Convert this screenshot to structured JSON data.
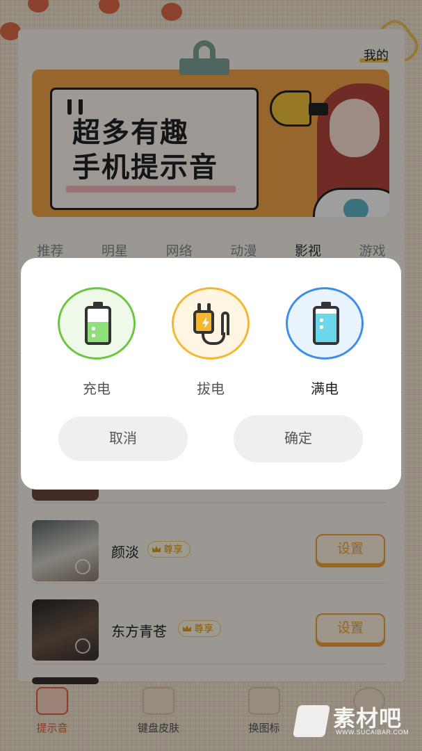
{
  "header": {
    "mine_label": "我的"
  },
  "banner": {
    "line1": "超多有趣",
    "line2": "手机提示音"
  },
  "categories": [
    {
      "label": "推荐",
      "active": false
    },
    {
      "label": "明星",
      "active": false
    },
    {
      "label": "网络",
      "active": false
    },
    {
      "label": "动漫",
      "active": false
    },
    {
      "label": "影视",
      "active": true
    },
    {
      "label": "游戏",
      "active": false
    }
  ],
  "list": [
    {
      "name": "颜淡",
      "badge": "尊享",
      "action": "设置"
    },
    {
      "name": "东方青苍",
      "badge": "尊享",
      "action": "设置"
    }
  ],
  "tabbar": [
    {
      "label": "提示音",
      "icon": "bell-icon",
      "active": true
    },
    {
      "label": "键盘皮肤",
      "icon": "keyboard-icon",
      "active": false
    },
    {
      "label": "换图标",
      "icon": "puzzle-icon",
      "active": false
    },
    {
      "label": "",
      "icon": "chat-icon",
      "active": false
    }
  ],
  "watermark": {
    "text": "素材吧",
    "url": "WWW.SUCAIBAR.COM"
  },
  "dialog": {
    "options": [
      {
        "label": "充电",
        "icon": "battery-charging-icon",
        "color": "#6cc640",
        "battery_level": 0.6,
        "selected": false
      },
      {
        "label": "拔电",
        "icon": "plug-icon",
        "color": "#f4b731",
        "selected": false
      },
      {
        "label": "满电",
        "icon": "battery-full-icon",
        "color": "#3d8ee8",
        "battery_level": 0.85,
        "selected": true
      }
    ],
    "cancel_label": "取消",
    "confirm_label": "确定"
  },
  "colors": {
    "accent": "#f0a33a",
    "tab_active": "#e0623a",
    "vip": "#d79a1f"
  }
}
